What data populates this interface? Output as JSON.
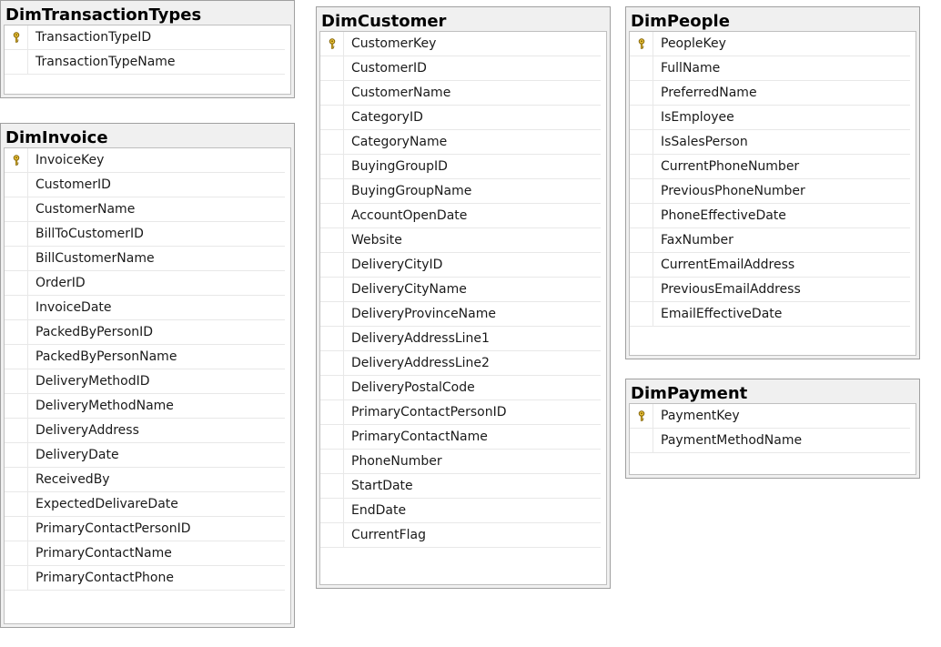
{
  "tables": [
    {
      "id": "dim-transaction-types",
      "title": "DimTransactionTypes",
      "columns": [
        {
          "name": "TransactionTypeID",
          "key": true
        },
        {
          "name": "TransactionTypeName",
          "key": false
        }
      ]
    },
    {
      "id": "dim-invoice",
      "title": "DimInvoice",
      "columns": [
        {
          "name": "InvoiceKey",
          "key": true
        },
        {
          "name": "CustomerID",
          "key": false
        },
        {
          "name": "CustomerName",
          "key": false
        },
        {
          "name": "BillToCustomerID",
          "key": false
        },
        {
          "name": "BillCustomerName",
          "key": false
        },
        {
          "name": "OrderID",
          "key": false
        },
        {
          "name": "InvoiceDate",
          "key": false
        },
        {
          "name": "PackedByPersonID",
          "key": false
        },
        {
          "name": "PackedByPersonName",
          "key": false
        },
        {
          "name": "DeliveryMethodID",
          "key": false
        },
        {
          "name": "DeliveryMethodName",
          "key": false
        },
        {
          "name": "DeliveryAddress",
          "key": false
        },
        {
          "name": "DeliveryDate",
          "key": false
        },
        {
          "name": "ReceivedBy",
          "key": false
        },
        {
          "name": "ExpectedDelivareDate",
          "key": false
        },
        {
          "name": "PrimaryContactPersonID",
          "key": false
        },
        {
          "name": "PrimaryContactName",
          "key": false
        },
        {
          "name": "PrimaryContactPhone",
          "key": false
        }
      ]
    },
    {
      "id": "dim-customer",
      "title": "DimCustomer",
      "columns": [
        {
          "name": "CustomerKey",
          "key": true
        },
        {
          "name": "CustomerID",
          "key": false
        },
        {
          "name": "CustomerName",
          "key": false
        },
        {
          "name": "CategoryID",
          "key": false
        },
        {
          "name": "CategoryName",
          "key": false
        },
        {
          "name": "BuyingGroupID",
          "key": false
        },
        {
          "name": "BuyingGroupName",
          "key": false
        },
        {
          "name": "AccountOpenDate",
          "key": false
        },
        {
          "name": "Website",
          "key": false
        },
        {
          "name": "DeliveryCityID",
          "key": false
        },
        {
          "name": "DeliveryCityName",
          "key": false
        },
        {
          "name": "DeliveryProvinceName",
          "key": false
        },
        {
          "name": "DeliveryAddressLine1",
          "key": false
        },
        {
          "name": "DeliveryAddressLine2",
          "key": false
        },
        {
          "name": "DeliveryPostalCode",
          "key": false
        },
        {
          "name": "PrimaryContactPersonID",
          "key": false
        },
        {
          "name": "PrimaryContactName",
          "key": false
        },
        {
          "name": "PhoneNumber",
          "key": false
        },
        {
          "name": "StartDate",
          "key": false
        },
        {
          "name": "EndDate",
          "key": false
        },
        {
          "name": "CurrentFlag",
          "key": false
        }
      ]
    },
    {
      "id": "dim-people",
      "title": "DimPeople",
      "columns": [
        {
          "name": "PeopleKey",
          "key": true
        },
        {
          "name": "FullName",
          "key": false
        },
        {
          "name": "PreferredName",
          "key": false
        },
        {
          "name": "IsEmployee",
          "key": false
        },
        {
          "name": "IsSalesPerson",
          "key": false
        },
        {
          "name": "CurrentPhoneNumber",
          "key": false
        },
        {
          "name": "PreviousPhoneNumber",
          "key": false
        },
        {
          "name": "PhoneEffectiveDate",
          "key": false
        },
        {
          "name": "FaxNumber",
          "key": false
        },
        {
          "name": "CurrentEmailAddress",
          "key": false
        },
        {
          "name": "PreviousEmailAddress",
          "key": false
        },
        {
          "name": "EmailEffectiveDate",
          "key": false
        }
      ]
    },
    {
      "id": "dim-payment",
      "title": "DimPayment",
      "columns": [
        {
          "name": "PaymentKey",
          "key": true
        },
        {
          "name": "PaymentMethodName",
          "key": false
        }
      ]
    }
  ],
  "icons": {
    "primary_key": "key-icon"
  },
  "colors": {
    "key_icon": "#e8c23a",
    "key_outline": "#7a5a00",
    "title_bar": "#f0f0f0",
    "border": "#a0a0a0"
  }
}
